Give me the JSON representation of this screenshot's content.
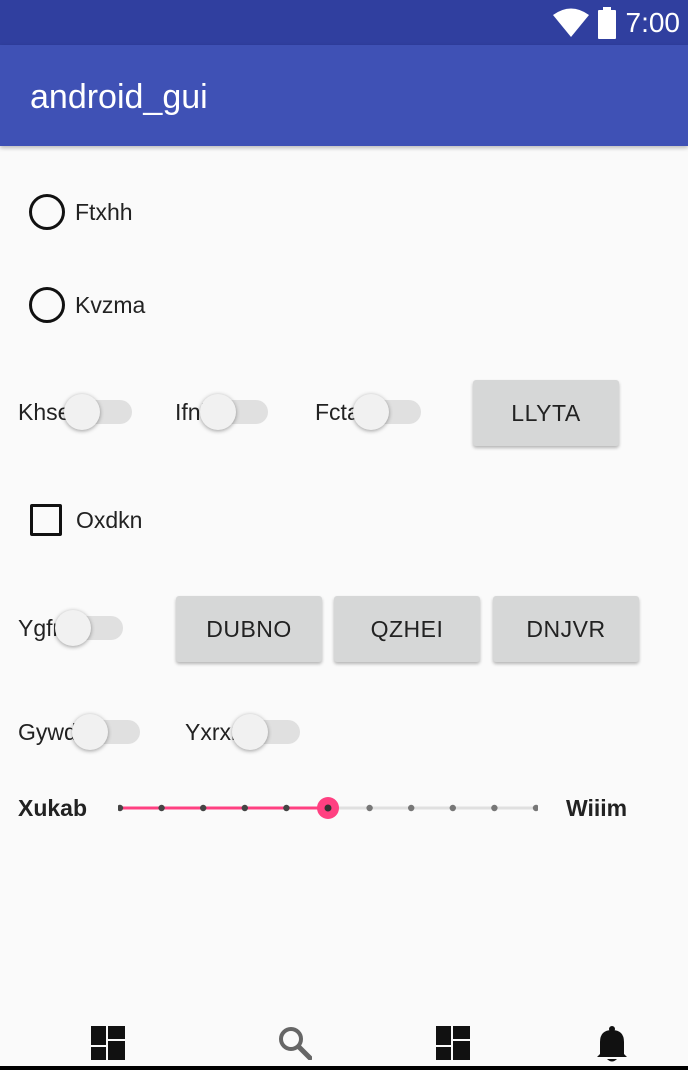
{
  "status_bar": {
    "time": "7:00",
    "icons": [
      "wifi-icon",
      "battery-icon"
    ]
  },
  "app_bar": {
    "title": "android_gui"
  },
  "radios": [
    {
      "label": "Ftxhh",
      "checked": false
    },
    {
      "label": "Kvzma",
      "checked": false
    }
  ],
  "row1": {
    "switches": [
      {
        "label": "Khsez",
        "on": false
      },
      {
        "label": "Ifnbi",
        "on": false
      },
      {
        "label": "Fctav",
        "on": false
      }
    ],
    "button": "LLYTA"
  },
  "checkbox": {
    "label": "Oxdkn",
    "checked": false
  },
  "row2": {
    "switch": {
      "label": "Ygfrq",
      "on": false
    },
    "buttons": [
      "DUBNO",
      "QZHEI",
      "DNJVR"
    ]
  },
  "row3": {
    "switches": [
      {
        "label": "Gywdp",
        "on": false
      },
      {
        "label": "Yxrxm",
        "on": false
      }
    ]
  },
  "seekbar": {
    "min_label": "Xukab",
    "max_label": "Wiiim",
    "steps": 10,
    "value": 5
  },
  "bottom_nav": [
    "dashboard-icon",
    "search-icon",
    "dashboard-icon",
    "notifications-icon"
  ],
  "colors": {
    "status_bar": "#303f9f",
    "app_bar": "#3f51b5",
    "accent": "#ff4081",
    "background": "#fafafa"
  }
}
